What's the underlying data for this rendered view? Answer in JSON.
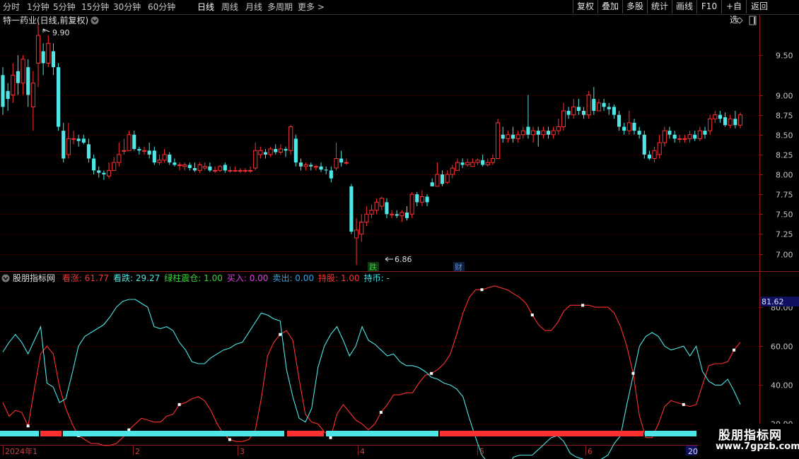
{
  "toolbar": {
    "periods": [
      "分时",
      "1分钟",
      "5分钟",
      "15分钟",
      "30分钟",
      "60分钟",
      "日线",
      "周线",
      "月线",
      "多周期",
      "更多 >"
    ],
    "active_period": "日线",
    "buttons": [
      "复权",
      "叠加",
      "多股",
      "统计",
      "画线",
      "F10",
      "+自选",
      "返回"
    ]
  },
  "main_chart": {
    "title": "特一药业(日线,前复权)",
    "high_label": "9.90",
    "low_label": "6.86",
    "tags": [
      {
        "text": "跌",
        "color": "#2ecc40"
      },
      {
        "text": "财",
        "color": "#3b6fd6"
      }
    ],
    "y_ticks": [
      "9.50",
      "9.00",
      "8.75",
      "8.50",
      "8.25",
      "8.00",
      "7.75",
      "7.50",
      "7.25",
      "7.00"
    ]
  },
  "indicator": {
    "name": "股朋指标网",
    "fields": [
      {
        "label": "看涨: ",
        "value": "61.77",
        "color": "#ff3030"
      },
      {
        "label": "看跌: ",
        "value": "29.27",
        "color": "#4ee6e6"
      },
      {
        "label": "绿柱震仓: ",
        "value": "1.00",
        "color": "#3ad23a"
      },
      {
        "label": "买入: ",
        "value": "0.00",
        "color": "#e040e0"
      },
      {
        "label": "卖出: ",
        "value": "0.00",
        "color": "#3aa0e0"
      },
      {
        "label": "持股: ",
        "value": "1.00",
        "color": "#ff3030"
      },
      {
        "label": "持币: ",
        "value": "-",
        "color": "#4ee6e6"
      }
    ],
    "y_ticks": [
      "80.00",
      "60.00",
      "40.00",
      "20.00"
    ],
    "current_value": "81.62"
  },
  "x_axis": {
    "labels": [
      "2024年1",
      "2",
      "3",
      "4",
      "5",
      "6",
      "20"
    ]
  },
  "watermark": {
    "title": "股朋指标网",
    "url": "www.7gpzb.com"
  },
  "colors": {
    "up": "#ff3030",
    "down": "#4ee6e6",
    "bull": "#ff3030",
    "bear": "#4ee6e6"
  },
  "chart_data": [
    {
      "type": "candlestick",
      "ylim": [
        6.8,
        10.0
      ],
      "candles": [
        [
          9.25,
          8.85,
          9.35,
          8.75
        ],
        [
          9.05,
          8.95,
          9.15,
          8.8
        ],
        [
          9.0,
          9.25,
          9.4,
          8.9
        ],
        [
          9.3,
          9.15,
          9.5,
          9.0
        ],
        [
          9.15,
          9.45,
          9.5,
          9.0
        ],
        [
          9.35,
          9.0,
          9.45,
          8.85
        ],
        [
          8.85,
          9.15,
          9.3,
          8.55
        ],
        [
          9.4,
          9.75,
          9.9,
          9.1
        ],
        [
          9.55,
          9.4,
          9.65,
          9.25
        ],
        [
          9.4,
          9.65,
          9.75,
          9.35
        ],
        [
          9.55,
          9.35,
          9.65,
          9.25
        ],
        [
          9.35,
          8.6,
          9.4,
          8.55
        ],
        [
          8.55,
          8.2,
          8.65,
          8.15
        ],
        [
          8.25,
          8.45,
          8.65,
          8.2
        ],
        [
          8.45,
          8.45,
          8.55,
          8.38
        ],
        [
          8.45,
          8.42,
          8.5,
          8.35
        ],
        [
          8.45,
          8.4,
          8.5,
          8.38
        ],
        [
          8.38,
          8.2,
          8.45,
          8.15
        ],
        [
          8.2,
          8.05,
          8.25,
          8.0
        ],
        [
          8.05,
          8.02,
          8.1,
          7.96
        ],
        [
          8.02,
          8.0,
          8.05,
          7.93
        ],
        [
          7.98,
          8.05,
          8.15,
          7.95
        ],
        [
          8.05,
          8.15,
          8.22,
          8.05
        ],
        [
          8.15,
          8.25,
          8.4,
          8.1
        ],
        [
          8.3,
          8.3,
          8.45,
          8.25
        ],
        [
          8.3,
          8.5,
          8.55,
          8.3
        ],
        [
          8.5,
          8.32,
          8.55,
          8.3
        ],
        [
          8.32,
          8.3,
          8.35,
          8.25
        ],
        [
          8.3,
          8.3,
          8.35,
          8.25
        ],
        [
          8.3,
          8.25,
          8.4,
          8.2
        ],
        [
          8.3,
          8.15,
          8.35,
          8.12
        ],
        [
          8.15,
          8.18,
          8.25,
          8.12
        ],
        [
          8.18,
          8.25,
          8.32,
          8.15
        ],
        [
          8.25,
          8.15,
          8.28,
          8.12
        ],
        [
          8.15,
          8.12,
          8.2,
          8.1
        ],
        [
          8.12,
          8.12,
          8.15,
          8.05
        ],
        [
          8.1,
          8.12,
          8.15,
          8.05
        ],
        [
          8.12,
          8.08,
          8.15,
          8.05
        ],
        [
          8.08,
          8.05,
          8.15,
          8.03
        ],
        [
          8.05,
          8.12,
          8.15,
          8.02
        ],
        [
          8.08,
          8.1,
          8.15,
          8.05
        ],
        [
          8.1,
          8.05,
          8.15,
          8.03
        ],
        [
          8.05,
          8.05,
          8.1,
          8.02
        ],
        [
          8.05,
          8.1,
          8.12,
          8.03
        ],
        [
          8.12,
          8.05,
          8.15,
          8.02
        ],
        [
          8.05,
          8.05,
          8.1,
          8.02
        ],
        [
          8.05,
          8.05,
          8.1,
          8.03
        ],
        [
          8.05,
          8.05,
          8.08,
          8.02
        ],
        [
          8.05,
          8.05,
          8.08,
          8.02
        ],
        [
          8.05,
          8.05,
          8.1,
          8.02
        ],
        [
          8.08,
          8.3,
          8.4,
          8.05
        ],
        [
          8.25,
          8.3,
          8.35,
          8.2
        ],
        [
          8.28,
          8.25,
          8.32,
          8.2
        ],
        [
          8.25,
          8.32,
          8.35,
          8.22
        ],
        [
          8.32,
          8.28,
          8.38,
          8.25
        ],
        [
          8.28,
          8.32,
          8.38,
          8.25
        ],
        [
          8.32,
          8.3,
          8.35,
          8.22
        ],
        [
          8.3,
          8.6,
          8.62,
          8.25
        ],
        [
          8.45,
          8.15,
          8.5,
          8.1
        ],
        [
          8.15,
          8.1,
          8.2,
          8.05
        ],
        [
          8.1,
          8.12,
          8.15,
          8.05
        ],
        [
          8.12,
          8.1,
          8.15,
          8.05
        ],
        [
          8.1,
          8.1,
          8.12,
          8.05
        ],
        [
          8.1,
          8.06,
          8.15,
          8.03
        ],
        [
          8.06,
          8.05,
          8.1,
          8.0
        ],
        [
          8.05,
          7.95,
          8.1,
          7.9
        ],
        [
          8.08,
          8.2,
          8.4,
          8.05
        ],
        [
          8.2,
          8.15,
          8.3,
          8.1
        ],
        [
          8.15,
          8.15,
          8.2,
          8.12
        ],
        [
          7.85,
          7.28,
          7.88,
          7.25
        ],
        [
          7.2,
          7.3,
          7.45,
          6.86
        ],
        [
          7.25,
          7.4,
          7.5,
          7.15
        ],
        [
          7.4,
          7.5,
          7.6,
          7.35
        ],
        [
          7.5,
          7.55,
          7.62,
          7.45
        ],
        [
          7.55,
          7.65,
          7.7,
          7.5
        ],
        [
          7.6,
          7.7,
          7.72,
          7.55
        ],
        [
          7.65,
          7.5,
          7.7,
          7.45
        ],
        [
          7.5,
          7.5,
          7.55,
          7.45
        ],
        [
          7.5,
          7.48,
          7.55,
          7.45
        ],
        [
          7.48,
          7.52,
          7.55,
          7.4
        ],
        [
          7.52,
          7.45,
          7.6,
          7.42
        ],
        [
          7.5,
          7.75,
          7.78,
          7.45
        ],
        [
          7.75,
          7.65,
          7.78,
          7.6
        ],
        [
          7.65,
          7.72,
          7.8,
          7.6
        ],
        [
          7.72,
          7.65,
          7.75,
          7.6
        ],
        [
          7.9,
          7.85,
          7.95,
          7.85
        ],
        [
          7.85,
          8.0,
          8.15,
          7.85
        ],
        [
          8.0,
          7.88,
          8.05,
          7.85
        ],
        [
          7.9,
          8.0,
          8.05,
          7.88
        ],
        [
          8.0,
          8.08,
          8.12,
          7.95
        ],
        [
          8.05,
          8.15,
          8.2,
          8.05
        ],
        [
          8.15,
          8.12,
          8.2,
          8.08
        ],
        [
          8.12,
          8.15,
          8.2,
          8.1
        ],
        [
          8.1,
          8.15,
          8.2,
          8.1
        ],
        [
          8.15,
          8.18,
          8.2,
          8.12
        ],
        [
          8.18,
          8.12,
          8.25,
          8.1
        ],
        [
          8.12,
          8.15,
          8.2,
          8.1
        ],
        [
          8.15,
          8.2,
          8.25,
          8.12
        ],
        [
          8.2,
          8.65,
          8.7,
          8.2
        ],
        [
          8.5,
          8.45,
          8.6,
          8.4
        ],
        [
          8.45,
          8.5,
          8.55,
          8.4
        ],
        [
          8.5,
          8.45,
          8.6,
          8.4
        ],
        [
          8.45,
          8.5,
          8.55,
          8.4
        ],
        [
          8.5,
          8.55,
          8.6,
          8.45
        ],
        [
          8.6,
          8.5,
          9.0,
          8.45
        ],
        [
          8.5,
          8.55,
          8.6,
          8.4
        ],
        [
          8.55,
          8.5,
          8.6,
          8.35
        ],
        [
          8.5,
          8.55,
          8.6,
          8.45
        ],
        [
          8.55,
          8.5,
          8.6,
          8.45
        ],
        [
          8.5,
          8.55,
          8.6,
          8.45
        ],
        [
          8.55,
          8.6,
          8.7,
          8.5
        ],
        [
          8.6,
          8.8,
          8.9,
          8.55
        ],
        [
          8.8,
          8.75,
          8.85,
          8.7
        ],
        [
          8.75,
          8.85,
          8.95,
          8.7
        ],
        [
          8.85,
          8.8,
          8.95,
          8.75
        ],
        [
          8.8,
          8.75,
          8.85,
          8.7
        ],
        [
          8.75,
          9.0,
          9.05,
          8.7
        ],
        [
          8.95,
          8.8,
          9.1,
          8.75
        ],
        [
          8.8,
          8.9,
          8.95,
          8.8
        ],
        [
          8.9,
          8.85,
          8.95,
          8.8
        ],
        [
          8.85,
          8.82,
          8.9,
          8.75
        ],
        [
          8.85,
          8.75,
          8.88,
          8.7
        ],
        [
          8.75,
          8.6,
          8.8,
          8.55
        ],
        [
          8.6,
          8.55,
          8.65,
          8.5
        ],
        [
          8.55,
          8.65,
          8.8,
          8.5
        ],
        [
          8.65,
          8.55,
          8.7,
          8.5
        ],
        [
          8.55,
          8.5,
          8.6,
          8.45
        ],
        [
          8.5,
          8.25,
          8.55,
          8.2
        ],
        [
          8.25,
          8.2,
          8.3,
          8.18
        ],
        [
          8.2,
          8.3,
          8.35,
          8.15
        ],
        [
          8.25,
          8.4,
          8.5,
          8.2
        ],
        [
          8.4,
          8.55,
          8.6,
          8.35
        ],
        [
          8.55,
          8.5,
          8.6,
          8.45
        ],
        [
          8.5,
          8.45,
          8.55,
          8.4
        ],
        [
          8.45,
          8.45,
          8.5,
          8.4
        ],
        [
          8.45,
          8.45,
          8.5,
          8.4
        ],
        [
          8.45,
          8.5,
          8.55,
          8.4
        ],
        [
          8.5,
          8.45,
          8.55,
          8.42
        ],
        [
          8.45,
          8.55,
          8.6,
          8.42
        ],
        [
          8.55,
          8.5,
          8.6,
          8.45
        ],
        [
          8.55,
          8.7,
          8.75,
          8.5
        ],
        [
          8.7,
          8.75,
          8.8,
          8.65
        ],
        [
          8.75,
          8.7,
          8.8,
          8.65
        ],
        [
          8.72,
          8.62,
          8.78,
          8.6
        ],
        [
          8.62,
          8.7,
          8.75,
          8.58
        ],
        [
          8.7,
          8.62,
          8.8,
          8.58
        ],
        [
          8.62,
          8.75,
          8.78,
          8.58
        ]
      ]
    },
    {
      "type": "line",
      "ylim": [
        10,
        92
      ],
      "series": [
        {
          "name": "看涨",
          "color": "#ff3030",
          "values": [
            31,
            24,
            27,
            26,
            19,
            38,
            56,
            60,
            56,
            39,
            28,
            20,
            14,
            12,
            10,
            10,
            9,
            9,
            10,
            13,
            17,
            20,
            23,
            22,
            21,
            21,
            24,
            25,
            30,
            31,
            33,
            34,
            32,
            27,
            20,
            15,
            12,
            11,
            11,
            12,
            16,
            33,
            55,
            62,
            66,
            68,
            63,
            43,
            25,
            21,
            20,
            16,
            13,
            25,
            30,
            26,
            22,
            20,
            17,
            20,
            26,
            30,
            35,
            35,
            36,
            36,
            41,
            45,
            46,
            48,
            51,
            56,
            66,
            77,
            85,
            89,
            89,
            90,
            91,
            90,
            89,
            87,
            85,
            82,
            76,
            71,
            68,
            68,
            72,
            78,
            81,
            81,
            81,
            81,
            80,
            80,
            80,
            77,
            70,
            60,
            46,
            24,
            13,
            13,
            20,
            29,
            32,
            31,
            30,
            29,
            30,
            40,
            50,
            51,
            51,
            52,
            58,
            62
          ]
        },
        {
          "name": "看跌",
          "color": "#4ee6e6",
          "values": [
            57,
            62,
            66,
            62,
            56,
            63,
            70,
            41,
            39,
            31,
            33,
            46,
            60,
            65,
            67,
            69,
            71,
            75,
            80,
            83,
            84,
            84,
            82,
            80,
            70,
            69,
            70,
            68,
            62,
            58,
            52,
            51,
            51,
            54,
            56,
            58,
            59,
            61,
            62,
            67,
            72,
            77,
            76,
            74,
            73,
            48,
            34,
            23,
            21,
            28,
            49,
            60,
            66,
            70,
            63,
            55,
            60,
            70,
            63,
            61,
            58,
            55,
            56,
            52,
            50,
            50,
            49,
            47,
            44,
            43,
            41,
            40,
            38,
            34,
            23,
            13,
            4,
            0,
            0,
            -3,
            -4,
            3,
            4,
            4,
            4,
            7,
            10,
            13,
            14,
            11,
            5,
            3,
            2,
            1,
            1,
            2,
            4,
            10,
            14,
            30,
            45,
            60,
            65,
            67,
            65,
            60,
            58,
            59,
            60,
            55,
            60,
            47,
            42,
            40,
            40,
            43,
            37,
            30
          ]
        }
      ],
      "markers": [
        20,
        41,
        60,
        65,
        70,
        75,
        80,
        85,
        90
      ]
    },
    {
      "type": "bar",
      "name": "持股/持币",
      "segments": [
        [
          "bear",
          0,
          55
        ],
        [
          "bull",
          57,
          87
        ],
        [
          "bear",
          89,
          402
        ],
        [
          "bull",
          406,
          458
        ],
        [
          "bear",
          461,
          620
        ],
        [
          "bull",
          622,
          910
        ],
        [
          "bear",
          912,
          985
        ]
      ]
    }
  ]
}
